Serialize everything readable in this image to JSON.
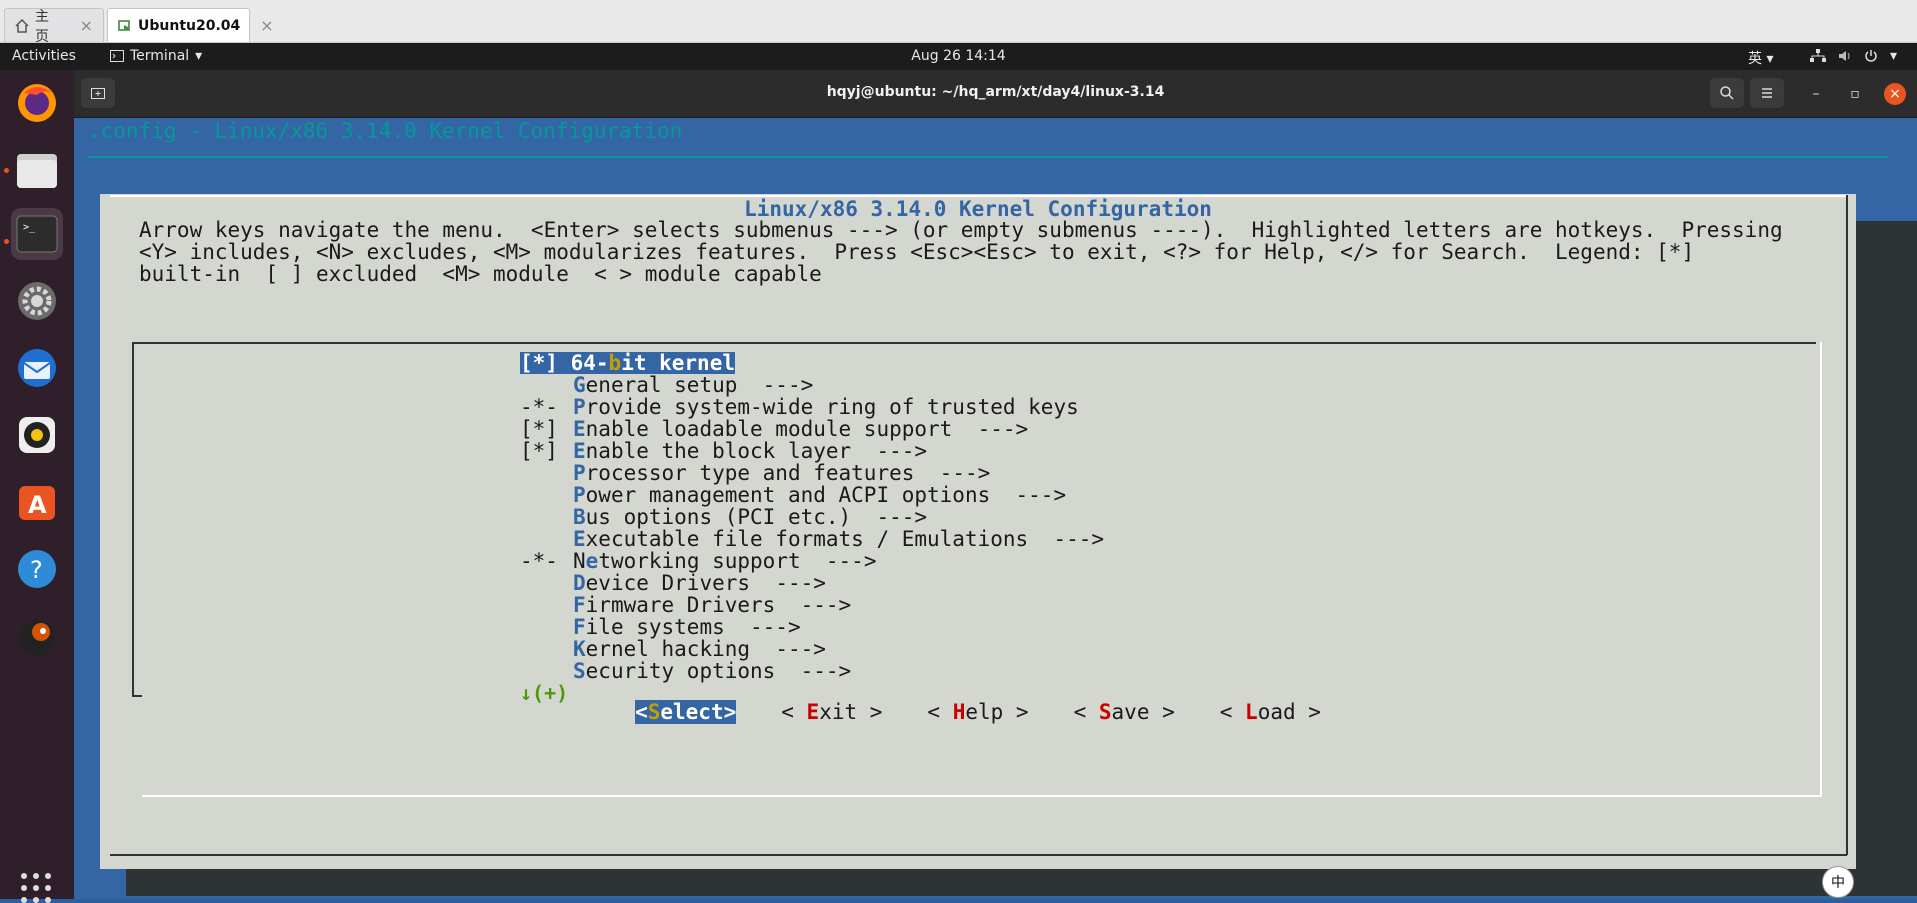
{
  "tabs": [
    {
      "label": "主页",
      "icon": "home-icon"
    },
    {
      "label": "Ubuntu20.04",
      "icon": "vm-icon"
    }
  ],
  "topbar": {
    "activities": "Activities",
    "app_menu": "Terminal",
    "clock": "Aug 26  14:14",
    "ime": "英"
  },
  "dock": {
    "items": [
      "firefox-icon",
      "files-icon",
      "terminal-icon",
      "settings-icon",
      "thunderbird-icon",
      "rhythmbox-icon",
      "software-icon",
      "help-icon",
      "gimp-icon"
    ]
  },
  "terminal": {
    "title": "hqyj@ubuntu: ~/hq_arm/xt/day4/linux-3.14"
  },
  "menuconfig": {
    "config_line": ".config - Linux/x86 3.14.0 Kernel Configuration",
    "dialog_title": "Linux/x86 3.14.0 Kernel Configuration",
    "help_lines": [
      "Arrow keys navigate the menu.  <Enter> selects submenus ---> (or empty submenus ----).  Highlighted letters are hotkeys.  Pressing",
      "<Y> includes, <N> excludes, <M> modularizes features.  Press <Esc><Esc> to exit, <?> for Help, </> for Search.  Legend: [*]",
      "built-in  [ ] excluded  <M> module  < > module capable"
    ],
    "items": [
      {
        "prefix": "[*]",
        "hot": "",
        "pre": "64-",
        "hotmid": "b",
        "rest": "it kernel",
        "arrow": "",
        "selected": true
      },
      {
        "prefix": "",
        "hot": "G",
        "rest": "eneral setup",
        "arrow": "  --->"
      },
      {
        "prefix": "-*-",
        "hot": "P",
        "rest": "rovide system-wide ring of trusted keys",
        "arrow": ""
      },
      {
        "prefix": "[*]",
        "hot": "E",
        "rest": "nable loadable module support",
        "arrow": "  --->"
      },
      {
        "prefix": "[*]",
        "hot": "E",
        "rest": "nable the block layer",
        "arrow": "  --->"
      },
      {
        "prefix": "",
        "hot": "P",
        "rest": "rocessor type and features",
        "arrow": "  --->"
      },
      {
        "prefix": "",
        "hot": "P",
        "rest": "ower management and ACPI options",
        "arrow": "  --->"
      },
      {
        "prefix": "",
        "hot": "B",
        "rest": "us options (PCI etc.)",
        "arrow": "  --->"
      },
      {
        "prefix": "",
        "hot": "E",
        "rest": "xecutable file formats / Emulations",
        "arrow": "  --->"
      },
      {
        "prefix": "-*-",
        "hot": "",
        "pre": "N",
        "hotmid": "e",
        "rest": "tworking support",
        "arrow": "  --->"
      },
      {
        "prefix": "",
        "hot": "D",
        "rest": "evice Drivers",
        "arrow": "  --->"
      },
      {
        "prefix": "",
        "hot": "F",
        "rest": "irmware Drivers",
        "arrow": "  --->"
      },
      {
        "prefix": "",
        "hot": "F",
        "rest": "ile systems",
        "arrow": "  --->"
      },
      {
        "prefix": "",
        "hot": "K",
        "rest": "ernel hacking",
        "arrow": "  --->"
      },
      {
        "prefix": "",
        "hot": "S",
        "rest": "ecurity options",
        "arrow": "  --->"
      }
    ],
    "more_indicator": "↓(+)",
    "buttons": [
      {
        "pre": "<",
        "hot": "S",
        "rest": "elect>",
        "selected": true
      },
      {
        "pre": "< ",
        "hot": "E",
        "rest": "xit >",
        "selected": false
      },
      {
        "pre": "< ",
        "hot": "H",
        "rest": "elp >",
        "selected": false
      },
      {
        "pre": "< ",
        "hot": "S",
        "rest": "ave >",
        "selected": false
      },
      {
        "pre": "< ",
        "hot": "L",
        "rest": "oad >",
        "selected": false
      }
    ]
  },
  "ime_badge": "中",
  "colors": {
    "terminal_bg": "#3465a4",
    "dialog_bg": "#d3d7cf",
    "hotkey_blue": "#3465a4",
    "hotkey_red": "#cc0000",
    "accent_orange": "#e95420"
  }
}
